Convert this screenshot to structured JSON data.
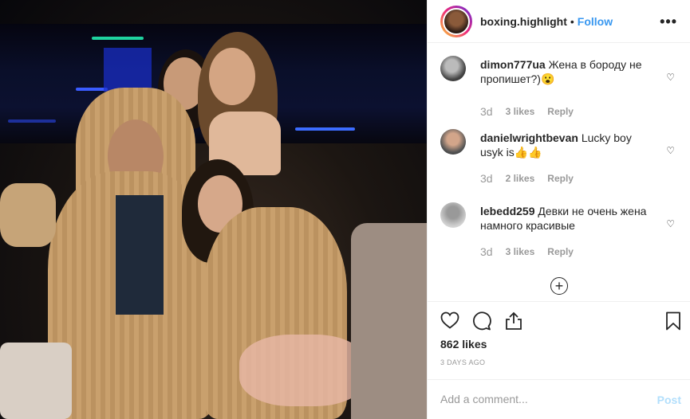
{
  "post": {
    "author": "boxing.highlight",
    "separator": "•",
    "follow_label": "Follow",
    "more_label": "•••",
    "likes": "862 likes",
    "date": "3 DAYS AGO",
    "comment_placeholder": "Add a comment...",
    "post_label": "Post"
  },
  "comments": [
    {
      "user": "dimon777ua",
      "text": "Жена в бороду не пропишет?)😮",
      "time": "3d",
      "likes": "3 likes",
      "reply": "Reply"
    },
    {
      "user": "danielwrightbevan",
      "text": "Lucky boy usyk is👍👍",
      "time": "3d",
      "likes": "2 likes",
      "reply": "Reply"
    },
    {
      "user": "lebedd259",
      "text": "Девки не очень жена намного красивые",
      "time": "3d",
      "likes": "3 likes",
      "reply": "Reply"
    }
  ],
  "icons": {
    "heart": "♡",
    "comment": "◯",
    "share": "⇪",
    "bookmark": "⌂",
    "load_more": "+"
  },
  "colors": {
    "accent": "#3897f0",
    "post_disabled": "#b2dffc",
    "meta": "#999999"
  }
}
